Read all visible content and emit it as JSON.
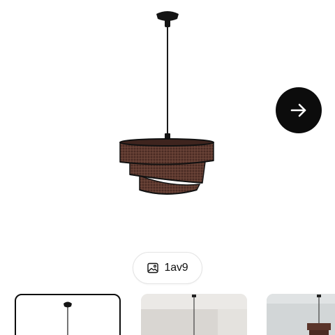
{
  "gallery": {
    "counter_text": "1av9",
    "next_icon": "arrow-right-icon",
    "counter_icon": "image-icon",
    "thumbnail_count_visible": 3,
    "active_thumbnail": 1
  },
  "colors": {
    "lamp_shade": "#5a342a",
    "button_bg": "#0c0c0c",
    "button_icon": "#ffffff"
  }
}
